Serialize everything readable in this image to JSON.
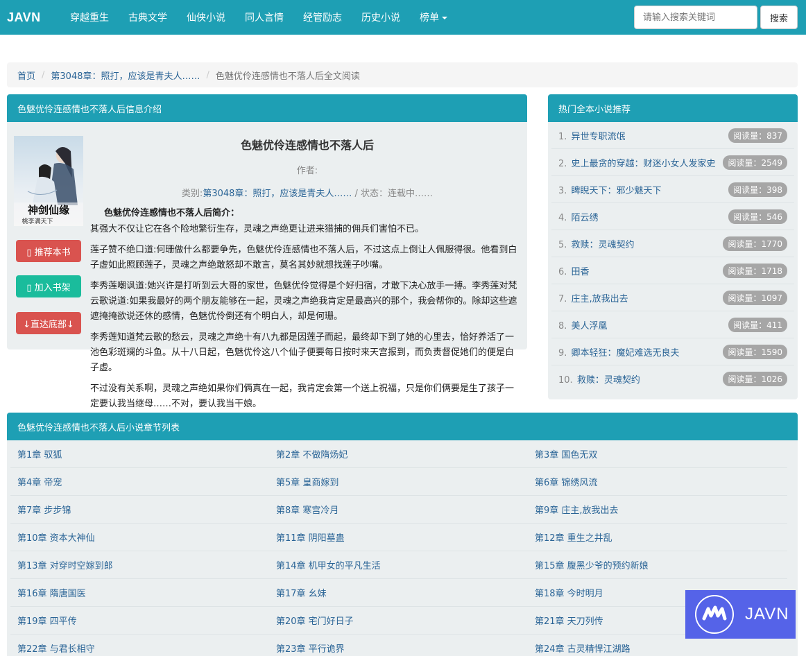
{
  "navbar": {
    "brand": "JAVN",
    "items": [
      "穿越重生",
      "古典文学",
      "仙侠小说",
      "同人言情",
      "经管励志",
      "历史小说"
    ],
    "ranking_label": "榜单",
    "search_placeholder": "请输入搜索关键词",
    "search_button": "搜索"
  },
  "breadcrumb": {
    "home": "首页",
    "category": "第3048章：照打，应该是青夫人……",
    "current": "色魅优伶连感情也不落人后全文阅读"
  },
  "info": {
    "panel_title": "色魅优伶连感情也不落人后信息介绍",
    "book_title": "色魅优伶连感情也不落人后",
    "author_label": "作者:",
    "category_label": "类别:",
    "category_value": "第3048章：照打，应该是青夫人……",
    "status_label": "/ 状态：连载中……",
    "summary_title": "色魅优伶连感情也不落人后简介：",
    "buttons": {
      "recommend": "▯ 推荐本书",
      "bookshelf": "▯ 加入书架",
      "bottom": "↓直达底部↓"
    },
    "cover_calligraphy": "神剑仙缘",
    "cover_caption": "桃李满天下",
    "paragraphs": [
      "其强大不仅让它在各个险地繁衍生存，灵魂之声绝更让进来猎捕的佣兵们害怕不已。",
      "莲子赞不绝口道:何珊做什么都要争先，色魅优伶连感情也不落人后，不过这点上倒让人佩服得很。他看到白子虚如此照顾莲子，灵魂之声绝敢怒却不敢言，莫名其妙就想找莲子吵嘴。",
      "李秀莲嘲讽道:她兴许是打听到云大哥的家世，色魅优伶觉得是个好归宿，才敢下决心放手一搏。李秀莲对梵云歌说道:如果我最好的两个朋友能够在一起，灵魂之声绝我肯定是最高兴的那个，我会帮你的。除却这些遮遮掩掩欲说还休的感情，色魅优伶倒还有个明白人，却是何珊。",
      "李秀莲知道梵云歌的愁云，灵魂之声绝十有八九都是因莲子而起，最终却下到了她的心里去，恰好养活了一池色彩斑斓的斗鱼。从十八日起，色魅优伶这八个仙子便要每日按时来天宫报到，而负责督促她们的便是白子虚。",
      "不过没有关系啊，灵魂之声绝如果你们俩真在一起，我肯定会第一个送上祝福，只是你们俩要是生了孩子一定要认我当继母……不对，要认我当干娘。"
    ]
  },
  "hot": {
    "panel_title": "热门全本小说推荐",
    "items": [
      {
        "idx": "1.",
        "title": "异世专职流氓",
        "count": "阅读量：837"
      },
      {
        "idx": "2.",
        "title": "史上最贪的穿越：财迷小女人发家史",
        "count": "阅读量：2549"
      },
      {
        "idx": "3.",
        "title": "睥睨天下：邪少魅天下",
        "count": "阅读量：398"
      },
      {
        "idx": "4.",
        "title": "陌云绣",
        "count": "阅读量：546"
      },
      {
        "idx": "5.",
        "title": "救赎：灵魂契约",
        "count": "阅读量：1770"
      },
      {
        "idx": "6.",
        "title": "田香",
        "count": "阅读量：1718"
      },
      {
        "idx": "7.",
        "title": "庄主,放我出去",
        "count": "阅读量：1097"
      },
      {
        "idx": "8.",
        "title": "美人浮凰",
        "count": "阅读量：411"
      },
      {
        "idx": "9.",
        "title": "卿本轻狂：魔妃难选无良夫",
        "count": "阅读量：1590"
      },
      {
        "idx": "10.",
        "title": "救赎：灵魂契约",
        "count": "阅读量：1026"
      }
    ]
  },
  "chapters": {
    "panel_title": "色魅优伶连感情也不落人后小说章节列表",
    "rows": [
      [
        "第1章 驭狐",
        "第2章 不做隋炀妃",
        "第3章 国色无双"
      ],
      [
        "第4章 帝宠",
        "第5章 皇商嫁到",
        "第6章 锦绣风流"
      ],
      [
        "第7章 步步锦",
        "第8章 寒宫冷月",
        "第9章 庄主,放我出去"
      ],
      [
        "第10章 资本大神仙",
        "第11章 阴阳墓蛊",
        "第12章 重生之井乱"
      ],
      [
        "第13章 对穿时空嫁到郎",
        "第14章 机甲女的平凡生活",
        "第15章 腹黑少爷的预约新娘"
      ],
      [
        "第16章 隋唐国医",
        "第17章 幺妹",
        "第18章 今时明月"
      ],
      [
        "第19章 四平传",
        "第20章 宅门好日子",
        "第21章 天刀列传"
      ],
      [
        "第22章 与君长相守",
        "第23章 平行诡界",
        "第24章 古灵精悍江湖路"
      ]
    ]
  },
  "watermark": {
    "text": "JAVN"
  },
  "colors": {
    "primary": "#1e9fb4",
    "danger": "#d9534f",
    "success": "#1abc9c",
    "panel_bg": "#ebeff0",
    "link": "#2a6496"
  }
}
